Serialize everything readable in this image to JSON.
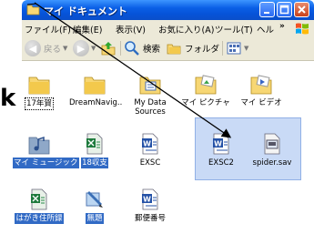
{
  "window": {
    "title": "マイ ドキュメント",
    "controls": [
      "minimize",
      "maximize",
      "close"
    ]
  },
  "menu": {
    "items": [
      "ファイル(F)",
      "編集(E)",
      "表示(V)",
      "お気に入り(A)",
      "ツール(T)",
      "ヘル"
    ],
    "more": "»"
  },
  "toolbar": {
    "back_label": "戻る",
    "search_label": "検索",
    "folders_label": "フォルダ"
  },
  "files": [
    {
      "name": "17年賀",
      "type": "folder",
      "selected": false
    },
    {
      "name": "DreamNavig..",
      "type": "folder",
      "selected": false
    },
    {
      "name": "My Data Sources",
      "type": "folder-special",
      "selected": false
    },
    {
      "name": "マイ ピクチャ",
      "type": "folder-pictures",
      "selected": false
    },
    {
      "name": "マイ ビデオ",
      "type": "folder-video",
      "selected": false
    },
    {
      "name": "マイ ミュージック",
      "type": "folder-music",
      "selected": true
    },
    {
      "name": "18収支",
      "type": "excel",
      "selected": true
    },
    {
      "name": "EXSC",
      "type": "word",
      "selected": false
    },
    {
      "name": "EXSC2",
      "type": "word",
      "selected": true
    },
    {
      "name": "spider.sav",
      "type": "sav",
      "selected": true
    },
    {
      "name": "はがき住所録",
      "type": "excel",
      "selected": true
    },
    {
      "name": "無題",
      "type": "paint",
      "selected": true
    },
    {
      "name": "郵便番号",
      "type": "word",
      "selected": false
    }
  ],
  "cursor": "k",
  "colors": {
    "selection": "#316ac5",
    "titlebar": "#0a5fe6",
    "drag_box": "#c9daf6"
  }
}
